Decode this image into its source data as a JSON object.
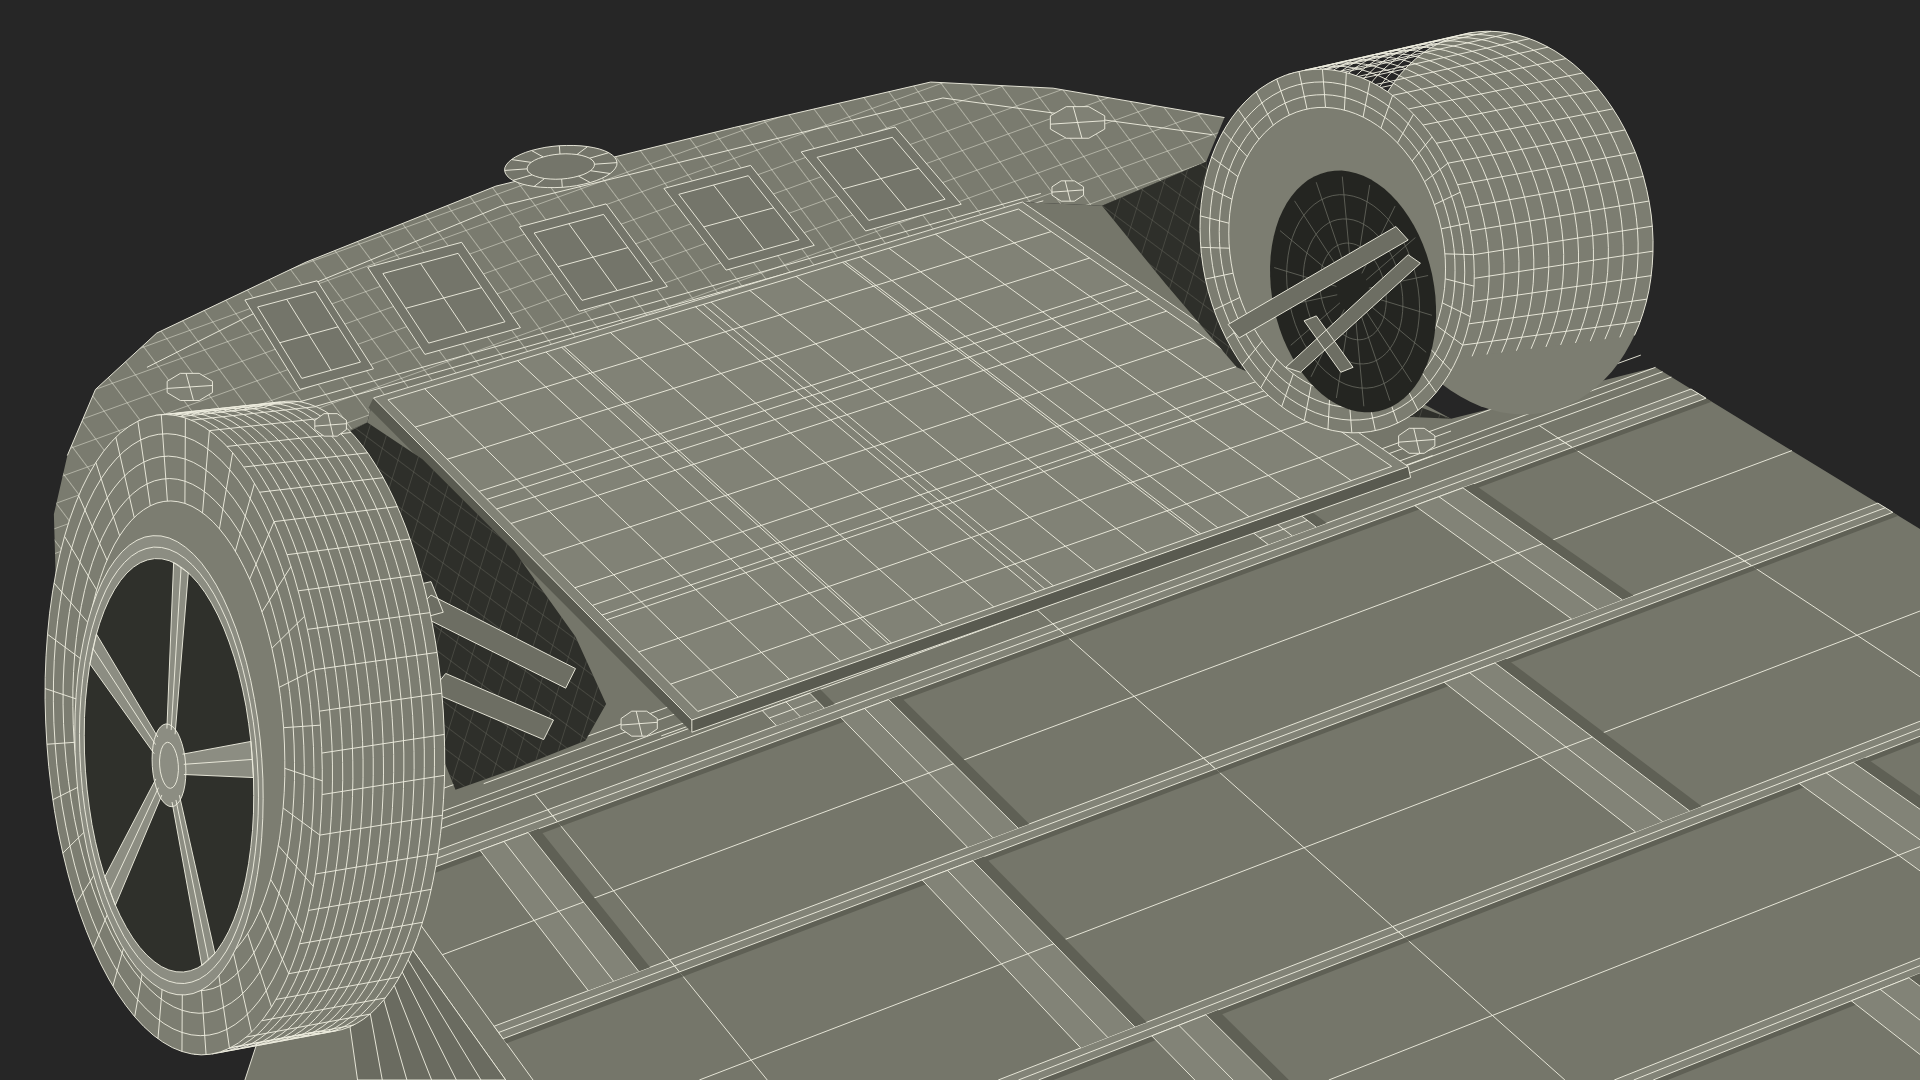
{
  "render": {
    "kind": "wireframe",
    "parts": [
      {
        "kind": "body-shell"
      },
      {
        "kind": "battery-tray"
      },
      {
        "kind": "floor-panel"
      },
      {
        "kind": "wheel"
      },
      {
        "kind": "wheel"
      },
      {
        "kind": "bolt"
      },
      {
        "kind": "bolt"
      },
      {
        "kind": "bolt"
      },
      {
        "kind": "bolt"
      },
      {
        "kind": "bolt"
      },
      {
        "kind": "bolt"
      }
    ]
  }
}
